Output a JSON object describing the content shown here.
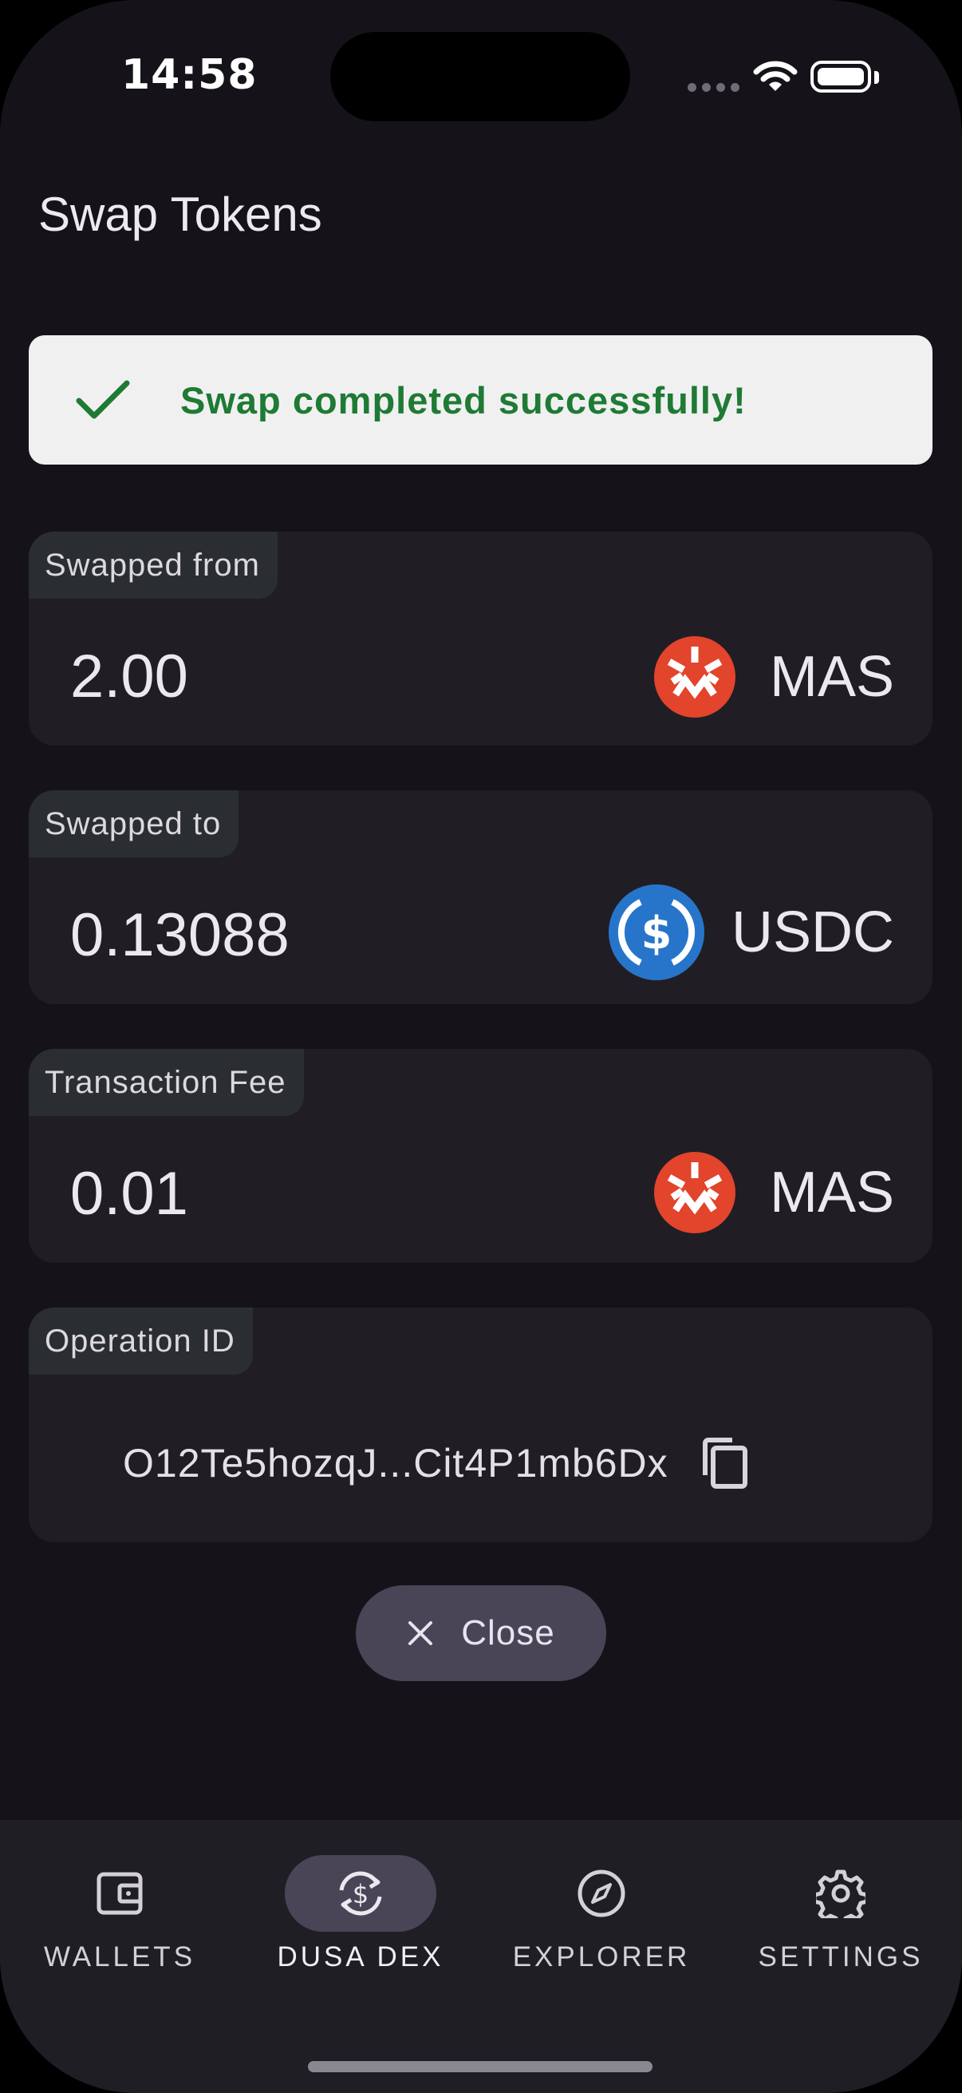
{
  "status_bar": {
    "time": "14:58"
  },
  "page": {
    "title": "Swap Tokens"
  },
  "banner": {
    "message": "Swap completed successfully!",
    "color": "#1f7a34"
  },
  "swapped_from": {
    "label": "Swapped from",
    "amount": "2.00",
    "token": "MAS",
    "token_icon": "massa-icon",
    "token_color": "#e2442c"
  },
  "swapped_to": {
    "label": "Swapped to",
    "amount": "0.13088",
    "token": "USDC",
    "token_icon": "usdc-icon",
    "token_color": "#2775ca"
  },
  "fee": {
    "label": "Transaction Fee",
    "amount": "0.01",
    "token": "MAS",
    "token_icon": "massa-icon"
  },
  "operation": {
    "label": "Operation ID",
    "value": "O12Te5hozqJ...Cit4P1mb6Dx",
    "copy_icon": "copy-icon"
  },
  "close_button": {
    "label": "Close",
    "icon": "close-icon"
  },
  "nav": {
    "items": [
      {
        "label": "WALLETS",
        "icon": "wallet-icon",
        "active": false
      },
      {
        "label": "DUSA DEX",
        "icon": "dollar-swap-icon",
        "active": true
      },
      {
        "label": "EXPLORER",
        "icon": "compass-icon",
        "active": false
      },
      {
        "label": "SETTINGS",
        "icon": "gear-icon",
        "active": false
      }
    ]
  }
}
